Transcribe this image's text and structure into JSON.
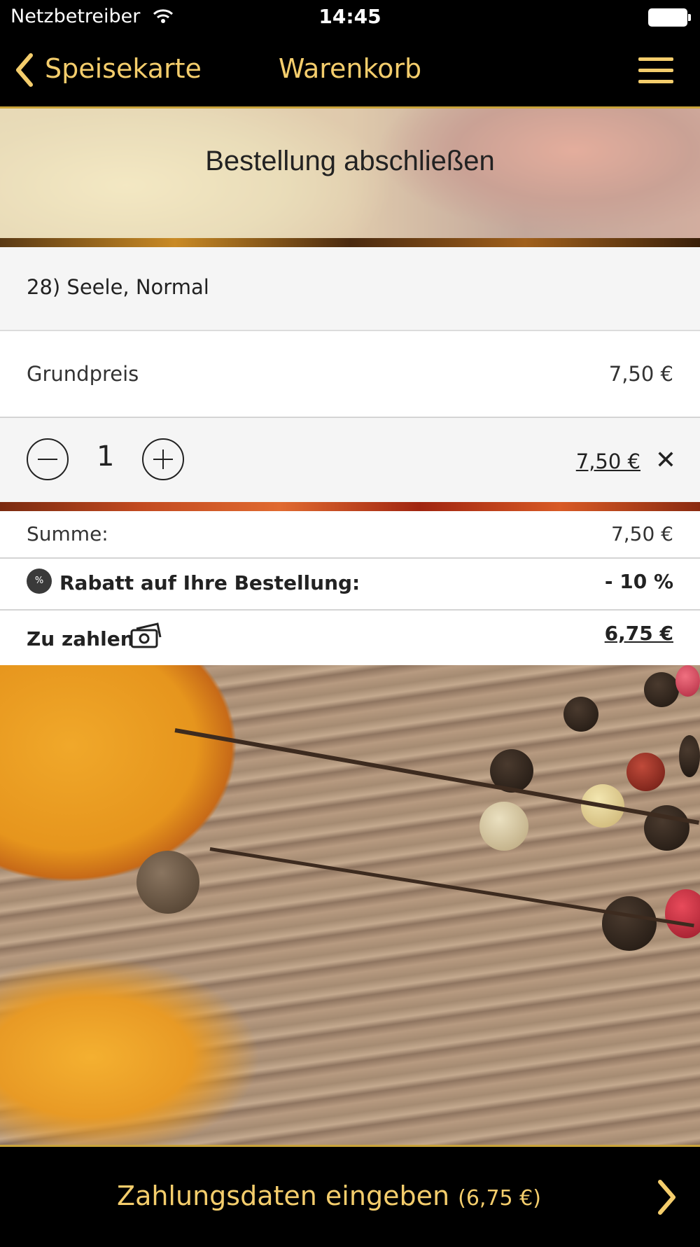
{
  "status_bar": {
    "carrier": "Netzbetreiber",
    "time": "14:45"
  },
  "nav": {
    "back_label": "Speisekarte",
    "title": "Warenkorb",
    "menu_icon": "hamburger-menu-icon"
  },
  "banner": {
    "title": "Bestellung abschließen"
  },
  "cart": {
    "item_name": "28) Seele, Normal",
    "base_label": "Grundpreis",
    "base_price": "7,50 €",
    "quantity": "1",
    "line_total": "7,50 €",
    "remove_symbol": "✕"
  },
  "totals": {
    "sum_label": "Summe:",
    "sum_value": "7,50 €",
    "discount_badge": "%",
    "discount_label": "Rabatt auf Ihre Bestellung:",
    "discount_value": "- 10 %",
    "pay_label": "Zu zahlen",
    "pay_value": "6,75 €"
  },
  "footer": {
    "checkout_label": "Zahlungsdaten eingeben",
    "checkout_amount": "(6,75 €)"
  },
  "colors": {
    "accent": "#f4cd6c",
    "bar_background": "#000000",
    "row_light": "#f5f5f5"
  }
}
